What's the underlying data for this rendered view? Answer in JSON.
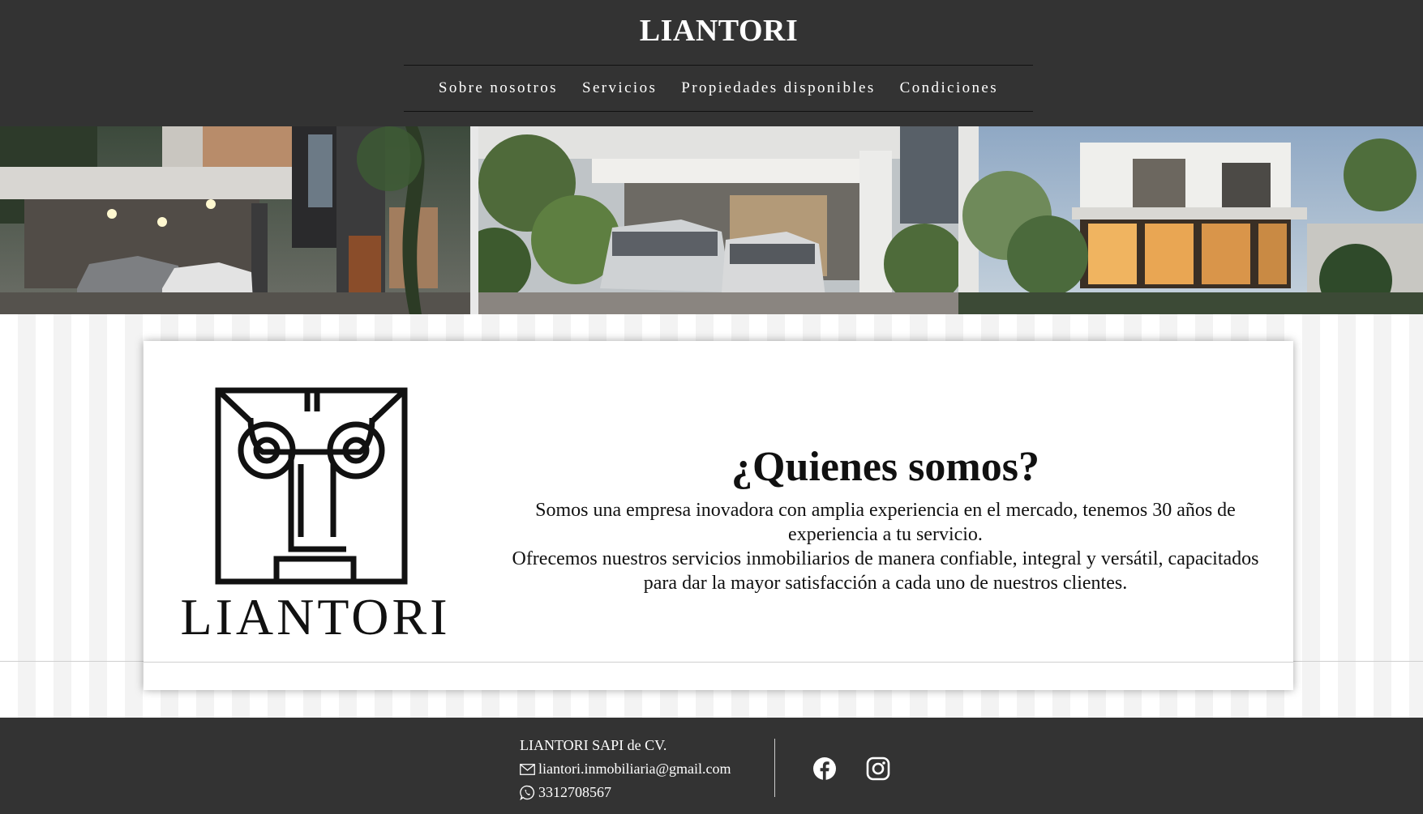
{
  "header": {
    "site_title": "LIANTORI",
    "nav": [
      {
        "label": "Sobre nosotros"
      },
      {
        "label": "Servicios"
      },
      {
        "label": "Propiedades disponibles"
      },
      {
        "label": "Condiciones"
      }
    ]
  },
  "hero": {
    "images": [
      {
        "icon": "house-photo-1"
      },
      {
        "icon": "house-photo-2"
      },
      {
        "icon": "house-photo-3"
      }
    ]
  },
  "about": {
    "logo_text": "LIANTORI",
    "title": "¿Quienes somos?",
    "paragraph_1": "Somos una empresa inovadora con amplia experiencia en el mercado, tenemos 30 años de experiencia a tu servicio.",
    "paragraph_2": "Ofrecemos nuestros servicios inmobiliarios de manera confiable, integral y versátil, capacitados para dar la mayor satisfacción a cada uno de nuestros clientes."
  },
  "footer": {
    "company": "LIANTORI SAPI de CV.",
    "email": "liantori.inmobiliaria@gmail.com",
    "phone": "3312708567",
    "social": [
      {
        "icon": "facebook-icon"
      },
      {
        "icon": "instagram-icon"
      }
    ]
  },
  "colors": {
    "header_bg": "#333333",
    "footer_bg": "#333333",
    "text_light": "#ffffff",
    "text_dark": "#111111"
  }
}
